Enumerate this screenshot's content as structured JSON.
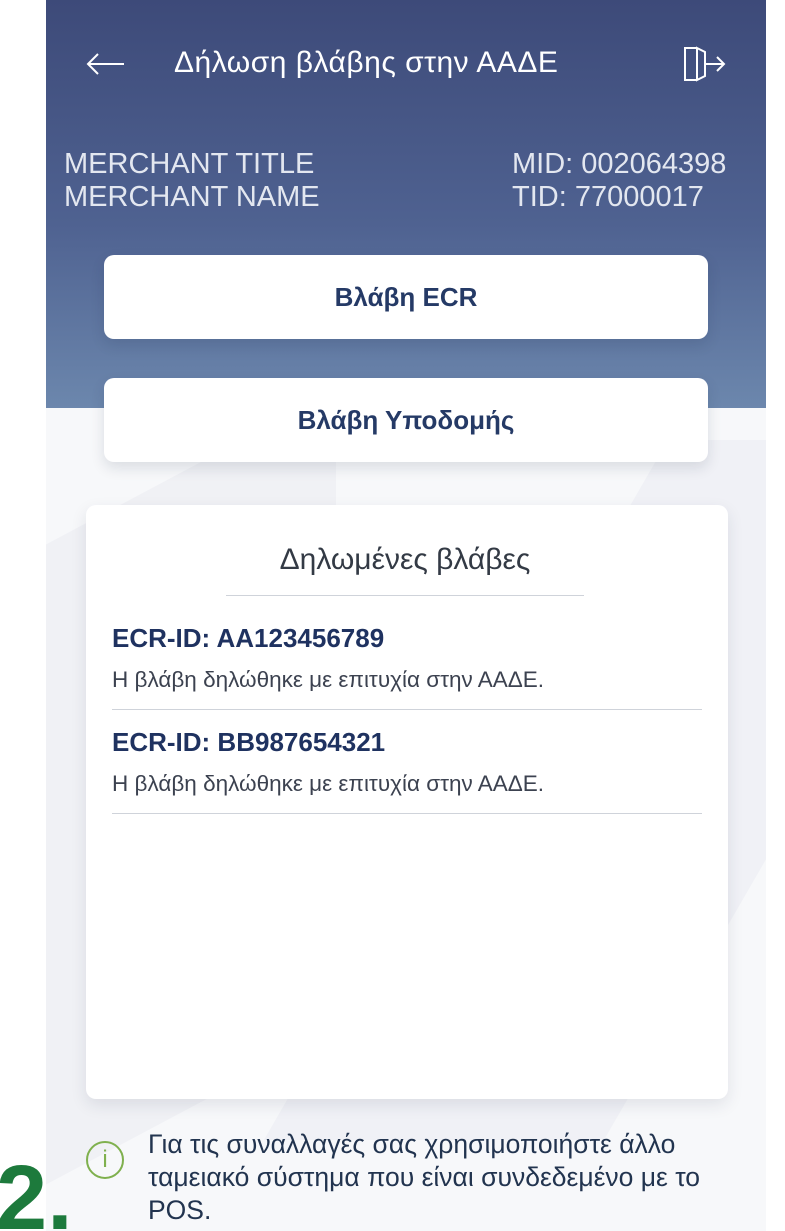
{
  "header": {
    "title": "Δήλωση βλάβης στην ΑΑΔΕ",
    "back_icon": "back-arrow-icon",
    "logout_icon": "logout-icon"
  },
  "merchant": {
    "title": "MERCHANT TITLE",
    "name": "MERCHANT NAME",
    "mid": "MID: 002064398",
    "tid": "TID: 77000017"
  },
  "buttons": {
    "ecr": "Βλάβη ECR",
    "infrastructure": "Βλάβη Υποδομής"
  },
  "declared_faults": {
    "title": "Δηλωμένες βλάβες",
    "items": [
      {
        "id": "ECR-ID: AA123456789",
        "message": "Η βλάβη δηλώθηκε με επιτυχία στην ΑΑΔΕ."
      },
      {
        "id": "ECR-ID: BB987654321",
        "message": "Η βλάβη δηλώθηκε με επιτυχία στην ΑΑΔΕ."
      }
    ]
  },
  "info": {
    "icon": "info-icon",
    "text": "Για τις συναλλαγές σας χρησιμοποιήστε άλλο ταμειακό σύστημα που είναι συνδεδεμένο με το POS."
  },
  "step_number": "2.",
  "colors": {
    "header_top": "#3d4a79",
    "header_bottom": "#6c87ad",
    "accent_text": "#1f3260",
    "info_green": "#7fb04e",
    "step_green": "#1d7a3c"
  }
}
